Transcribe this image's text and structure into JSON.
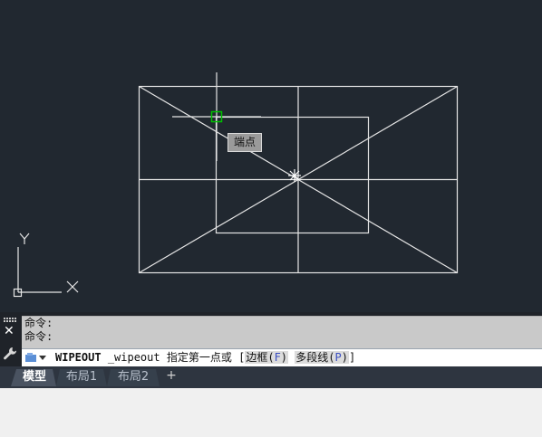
{
  "canvas": {
    "osnap_tooltip": "端点",
    "ucs": {
      "y_label": "Y",
      "x_label": "X"
    }
  },
  "command_line": {
    "history": [
      "命令:",
      "命令:"
    ],
    "command_name": "WIPEOUT",
    "command_alias": "_wipeout",
    "prompt": "指定第一点或",
    "options": [
      {
        "label": "边框",
        "key": "F"
      },
      {
        "label": "多段线",
        "key": "P"
      }
    ]
  },
  "tabs": [
    {
      "label": "模型",
      "active": true
    },
    {
      "label": "布局1",
      "active": false
    },
    {
      "label": "布局2",
      "active": false
    }
  ],
  "tab_add_symbol": "+",
  "colors": {
    "canvas_bg": "#212830",
    "geometry": "#e6e6e6",
    "snap_marker": "#00c000"
  },
  "icons": {
    "close": "close-icon",
    "customize": "wrench-icon",
    "grip": "grip-handle-icon",
    "command_icon": "command-line-icon",
    "dropdown": "chevron-down-icon",
    "add_layout": "plus-icon"
  }
}
